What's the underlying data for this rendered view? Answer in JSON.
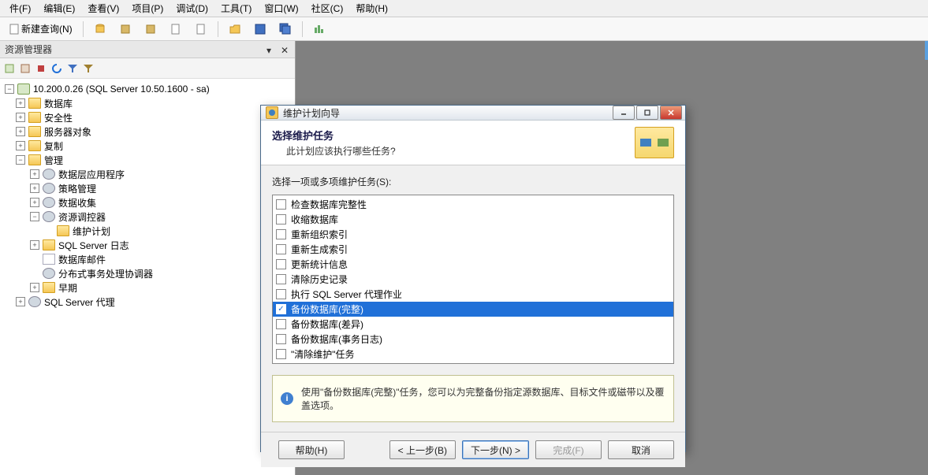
{
  "menubar": {
    "items": [
      "件(F)",
      "编辑(E)",
      "查看(V)",
      "项目(P)",
      "调试(D)",
      "工具(T)",
      "窗口(W)",
      "社区(C)",
      "帮助(H)"
    ]
  },
  "toolbar": {
    "new_query": "新建查询(N)"
  },
  "explorer": {
    "title": "资源管理器",
    "server": "10.200.0.26 (SQL Server 10.50.1600 - sa)",
    "nodes": {
      "databases": "数据库",
      "security": "安全性",
      "server_objects": "服务器对象",
      "replication": "复制",
      "management": "管理",
      "data_app": "数据层应用程序",
      "policy": "策略管理",
      "collection": "数据收集",
      "governor": "资源调控器",
      "maint_plan": "维护计划",
      "sql_log": "SQL Server 日志",
      "db_mail": "数据库邮件",
      "dtc": "分布式事务处理协调器",
      "legacy": "早期",
      "agent": "SQL Server 代理"
    }
  },
  "dialog": {
    "title": "维护计划向导",
    "header_title": "选择维护任务",
    "header_sub": "此计划应该执行哪些任务?",
    "prompt": "选择一项或多项维护任务(S):",
    "tasks": [
      {
        "label": "检查数据库完整性",
        "checked": false,
        "selected": false
      },
      {
        "label": "收缩数据库",
        "checked": false,
        "selected": false
      },
      {
        "label": "重新组织索引",
        "checked": false,
        "selected": false
      },
      {
        "label": "重新生成索引",
        "checked": false,
        "selected": false
      },
      {
        "label": "更新统计信息",
        "checked": false,
        "selected": false
      },
      {
        "label": "清除历史记录",
        "checked": false,
        "selected": false
      },
      {
        "label": "执行 SQL Server 代理作业",
        "checked": false,
        "selected": false
      },
      {
        "label": "备份数据库(完整)",
        "checked": true,
        "selected": true
      },
      {
        "label": "备份数据库(差异)",
        "checked": false,
        "selected": false
      },
      {
        "label": "备份数据库(事务日志)",
        "checked": false,
        "selected": false
      },
      {
        "label": "\"清除维护\"任务",
        "checked": false,
        "selected": false
      }
    ],
    "hint": "使用\"备份数据库(完整)\"任务，您可以为完整备份指定源数据库、目标文件或磁带以及覆盖选项。",
    "buttons": {
      "help": "帮助(H)",
      "back": "< 上一步(B)",
      "next": "下一步(N) >",
      "finish": "完成(F)",
      "cancel": "取消"
    }
  }
}
